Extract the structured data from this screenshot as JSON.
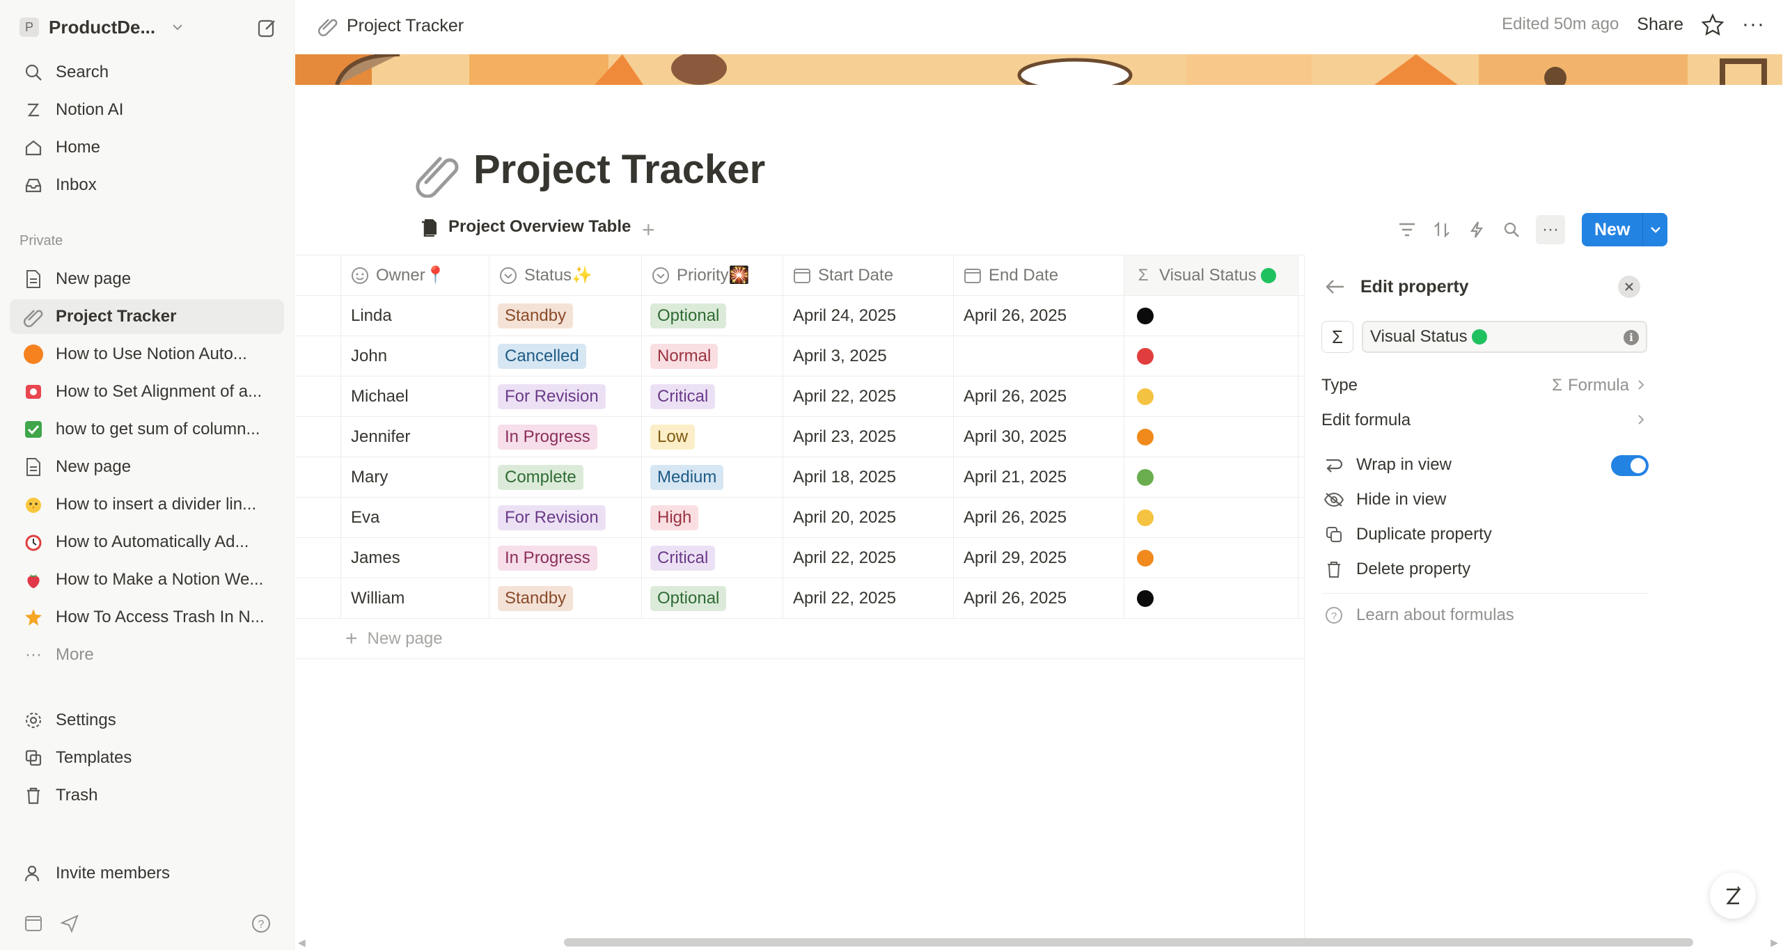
{
  "workspace": {
    "initial": "P",
    "name": "ProductDe..."
  },
  "sidebar": {
    "search": "Search",
    "notion_ai": "Notion AI",
    "home": "Home",
    "inbox": "Inbox",
    "section_private": "Private",
    "pages": [
      {
        "label": "New page",
        "icon": "page-icon"
      },
      {
        "label": "Project Tracker",
        "icon": "paperclip-icon",
        "active": true
      },
      {
        "label": "How to Use Notion Auto...",
        "icon": "orange-circle-icon"
      },
      {
        "label": "How to Set Alignment of a...",
        "icon": "red-tv-icon"
      },
      {
        "label": "how to get sum of column...",
        "icon": "green-check-icon"
      },
      {
        "label": "New page",
        "icon": "page-icon"
      },
      {
        "label": "How to insert a divider lin...",
        "icon": "chick-icon"
      },
      {
        "label": "How to Automatically Ad...",
        "icon": "alarm-clock-icon"
      },
      {
        "label": "How to Make a Notion We...",
        "icon": "strawberry-icon"
      },
      {
        "label": "How To Access Trash In N...",
        "icon": "star-burst-icon"
      }
    ],
    "more": "More",
    "settings": "Settings",
    "templates": "Templates",
    "trash": "Trash",
    "invite": "Invite members"
  },
  "topbar": {
    "breadcrumb": "Project Tracker",
    "edited": "Edited 50m ago",
    "share": "Share"
  },
  "page": {
    "title": "Project Tracker",
    "view_tab": "Project Overview Table",
    "new_button": "New"
  },
  "table": {
    "headers": {
      "owner": "Owner📍",
      "status": "Status✨",
      "priority": "Priority🎇",
      "start": "Start Date",
      "end": "End Date",
      "visual": "Visual Status"
    },
    "rows": [
      {
        "owner": "Linda",
        "status": "Standby",
        "priority": "Optional",
        "start": "April 24, 2025",
        "end": "April 26, 2025",
        "dot": "#0b0b0b"
      },
      {
        "owner": "John",
        "status": "Cancelled",
        "priority": "Normal",
        "start": "April 3, 2025",
        "end": "",
        "dot": "#e03e3e"
      },
      {
        "owner": "Michael",
        "status": "For Revision",
        "priority": "Critical",
        "start": "April 22, 2025",
        "end": "April 26, 2025",
        "dot": "#f5c342"
      },
      {
        "owner": "Jennifer",
        "status": "In Progress",
        "priority": "Low",
        "start": "April 23, 2025",
        "end": "April 30, 2025",
        "dot": "#f08a1c"
      },
      {
        "owner": "Mary",
        "status": "Complete",
        "priority": "Medium",
        "start": "April 18, 2025",
        "end": "April 21, 2025",
        "dot": "#6aad4f"
      },
      {
        "owner": "Eva",
        "status": "For Revision",
        "priority": "High",
        "start": "April 20, 2025",
        "end": "April 26, 2025",
        "dot": "#f5c342"
      },
      {
        "owner": "James",
        "status": "In Progress",
        "priority": "Critical",
        "start": "April 22, 2025",
        "end": "April 29, 2025",
        "dot": "#f08a1c"
      },
      {
        "owner": "William",
        "status": "Standby",
        "priority": "Optional",
        "start": "April 22, 2025",
        "end": "April 26, 2025",
        "dot": "#0b0b0b"
      }
    ],
    "new_page": "New page"
  },
  "tag_colors": {
    "Standby": {
      "bg": "#f4e2d7",
      "fg": "#8a4b2a"
    },
    "Cancelled": {
      "bg": "#d6e6f2",
      "fg": "#1f5b86"
    },
    "For Revision": {
      "bg": "#ece1f4",
      "fg": "#6a3a8a"
    },
    "In Progress": {
      "bg": "#f6deea",
      "fg": "#8a2f5c"
    },
    "Complete": {
      "bg": "#dcebd9",
      "fg": "#2f6b35"
    },
    "Optional": {
      "bg": "#dcebd9",
      "fg": "#2f6b35"
    },
    "Normal": {
      "bg": "#f9dfe2",
      "fg": "#9a3341"
    },
    "Critical": {
      "bg": "#ece1f4",
      "fg": "#6a3a8a"
    },
    "Low": {
      "bg": "#fbeec8",
      "fg": "#7f5a10"
    },
    "Medium": {
      "bg": "#d6e6f2",
      "fg": "#1f5b86"
    },
    "High": {
      "bg": "#f9dfe2",
      "fg": "#9a3341"
    }
  },
  "panel": {
    "title": "Edit property",
    "property_name": "Visual Status",
    "type_label": "Type",
    "type_value": "Formula",
    "edit_formula": "Edit formula",
    "wrap": "Wrap in view",
    "wrap_on": true,
    "hide": "Hide in view",
    "duplicate": "Duplicate property",
    "delete": "Delete property",
    "learn": "Learn about formulas"
  },
  "colors": {
    "accent": "#2383e2",
    "visual_status_dot": "#1fc15e"
  }
}
